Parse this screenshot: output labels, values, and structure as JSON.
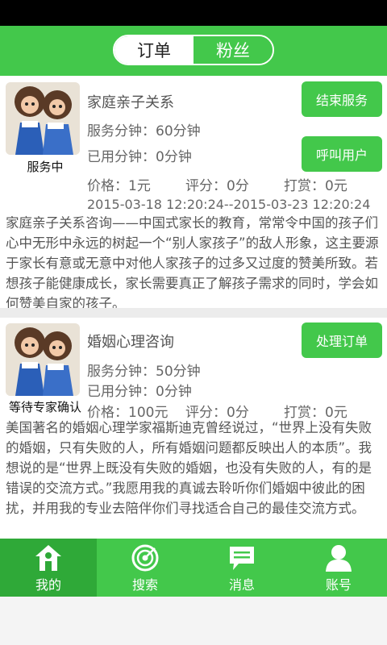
{
  "header": {
    "tabs": [
      {
        "label": "订单",
        "active": true
      },
      {
        "label": "粉丝",
        "active": false
      }
    ]
  },
  "orders": [
    {
      "status": "服务中",
      "title": "家庭亲子关系",
      "service_minutes": "服务分钟：60分钟",
      "used_minutes": "已用分钟：0分钟",
      "price": "价格：1元",
      "rating": "评分：0分",
      "tip": "打赏：0元",
      "date_range": "2015-03-18 12:20:24--2015-03-23 12:20:24",
      "description": "家庭亲子关系咨询——中国式家长的教育，常常令中国的孩子们心中无形中永远的树起一个“别人家孩子”的敌人形象，这主要源于家长有意或无意中对他人家孩子的过多又过度的赞美所致。若想孩子能健康成长，家长需要真正了解孩子需求的同时，学会如何赞美自家的孩子。",
      "buttons": [
        "结束服务",
        "呼叫用户"
      ]
    },
    {
      "status": "等待专家确认",
      "title": "婚姻心理咨询",
      "service_minutes": "服务分钟：50分钟",
      "used_minutes": "已用分钟：0分钟",
      "price": "价格：100元",
      "rating": "评分：0分",
      "tip": "打赏：0元",
      "description": "美国著名的婚姻心理学家福斯迪克曾经说过，“世界上没有失败的婚姻，只有失败的人，所有婚姻问题都反映出人的本质”。我想说的是“世界上既没有失败的婚姻，也没有失败的人，有的是错误的交流方式。”我愿用我的真诚去聆听你们婚姻中彼此的困扰，并用我的专业去陪伴你们寻找适合自己的最佳交流方式。",
      "buttons": [
        "处理订单"
      ]
    }
  ],
  "tabbar": {
    "items": [
      {
        "label": "我的",
        "icon": "home-icon",
        "active": true
      },
      {
        "label": "搜索",
        "icon": "target-icon",
        "active": false
      },
      {
        "label": "消息",
        "icon": "message-icon",
        "active": false
      },
      {
        "label": "账号",
        "icon": "user-icon",
        "active": false
      }
    ]
  },
  "colors": {
    "accent": "#43c84b",
    "accent_dark": "#2fa938"
  }
}
